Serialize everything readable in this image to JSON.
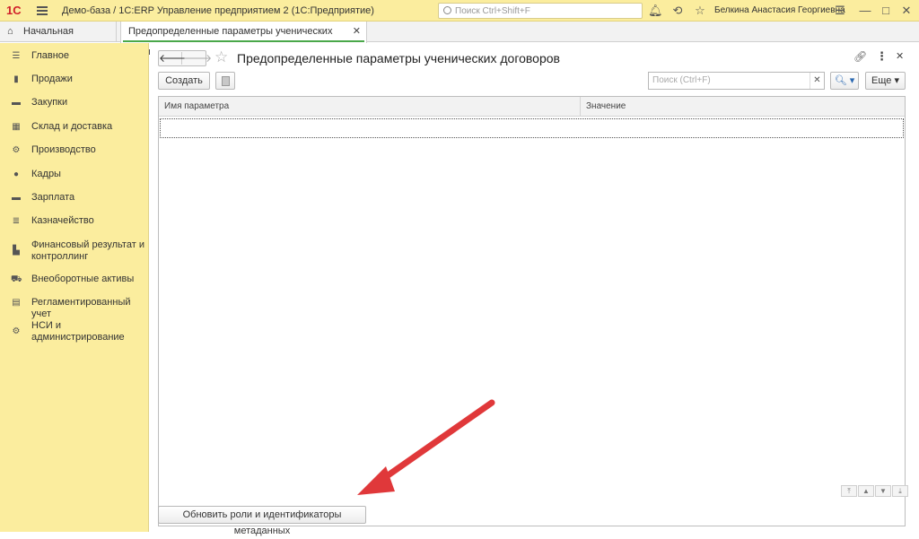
{
  "titlebar": {
    "logo": "1С",
    "title": "Демо-база / 1С:ERP Управление предприятием 2  (1С:Предприятие)",
    "search_placeholder": "Поиск Ctrl+Shift+F",
    "username": "Белкина Анастасия Георгиевна"
  },
  "tabs": {
    "home": "Начальная страница",
    "active": "Предопределенные параметры ученических договоров"
  },
  "sidebar": {
    "items": [
      {
        "label": "Главное",
        "icon": "menu-icon"
      },
      {
        "label": "Продажи",
        "icon": "bag-icon"
      },
      {
        "label": "Закупки",
        "icon": "cart-icon"
      },
      {
        "label": "Склад и доставка",
        "icon": "warehouse-icon"
      },
      {
        "label": "Производство",
        "icon": "factory-icon"
      },
      {
        "label": "Кадры",
        "icon": "person-icon"
      },
      {
        "label": "Зарплата",
        "icon": "wallet-icon"
      },
      {
        "label": "Казначейство",
        "icon": "coins-icon"
      },
      {
        "label": "Финансовый результат и контроллинг",
        "icon": "chart-icon"
      },
      {
        "label": "Внеоборотные активы",
        "icon": "truck-icon"
      },
      {
        "label": "Регламентированный учет",
        "icon": "document-icon"
      },
      {
        "label": "НСИ и администрирование",
        "icon": "gear-icon"
      }
    ]
  },
  "form": {
    "title": "Предопределенные параметры ученических договоров",
    "create_label": "Создать",
    "search_placeholder": "Поиск (Ctrl+F)",
    "more_label": "Еще",
    "columns": [
      "Имя параметра",
      "Значение"
    ],
    "update_button": "Обновить роли и идентификаторы метаданных"
  }
}
